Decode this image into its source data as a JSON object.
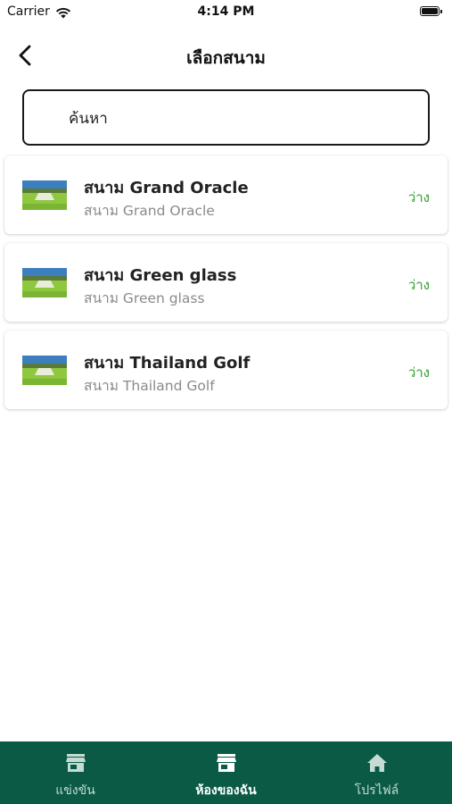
{
  "status_bar": {
    "carrier": "Carrier",
    "time": "4:14 PM"
  },
  "header": {
    "title": "เลือกสนาม",
    "back_icon": "chevron-left-icon"
  },
  "search": {
    "placeholder": "ค้นหา",
    "value": ""
  },
  "courses": [
    {
      "name": "สนาม Grand Oracle",
      "subtitle": "สนาม Grand Oracle",
      "status": "ว่าง"
    },
    {
      "name": "สนาม Green glass",
      "subtitle": "สนาม Green glass",
      "status": "ว่าง"
    },
    {
      "name": "สนาม Thailand Golf",
      "subtitle": "สนาม Thailand Golf",
      "status": "ว่าง"
    }
  ],
  "bottom_nav": {
    "items": [
      {
        "label": "แข่งขัน",
        "icon": "store-icon",
        "active": false
      },
      {
        "label": "ห้องของฉัน",
        "icon": "store-icon",
        "active": true
      },
      {
        "label": "โปรไฟล์",
        "icon": "home-icon",
        "active": false
      }
    ]
  },
  "colors": {
    "nav_background": "#0a5a45",
    "status_available": "#2ca02c",
    "subtitle_gray": "#8a8a8a"
  }
}
